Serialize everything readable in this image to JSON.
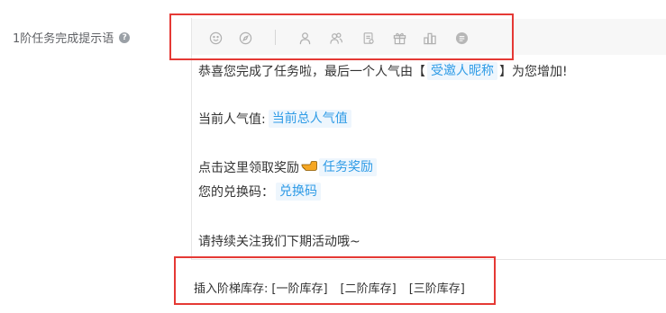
{
  "form": {
    "label": "1阶任务完成提示语",
    "help_glyph": "?"
  },
  "toolbar": {
    "icons": [
      "smile-icon",
      "compass-icon",
      "user-icon",
      "users-icon",
      "document-icon",
      "gift-icon",
      "ranking-icon",
      "coin-icon"
    ]
  },
  "content": {
    "line1_prefix": "恭喜您完成了任务啦，最后一个人气由【",
    "line1_tag": "受邀人昵称",
    "line1_suffix": "】为您增加!",
    "line2_prefix": "当前人气值:",
    "line2_tag": "当前总人气值",
    "line3_prefix": "点击这里领取奖励",
    "line3_tag": "任务奖励",
    "line4_prefix": "您的兑换码：",
    "line4_tag": "兑换码",
    "line5": "请持续关注我们下期活动哦~"
  },
  "insert": {
    "label": "插入阶梯库存:",
    "options": [
      "[一阶库存]",
      "[二阶库存]",
      "[三阶库存]"
    ]
  },
  "colors": {
    "highlight_box": "#e53935",
    "tag_text": "#2e9be6",
    "tag_background": "#eef6fd",
    "pointer_hand": "#f5a623"
  }
}
